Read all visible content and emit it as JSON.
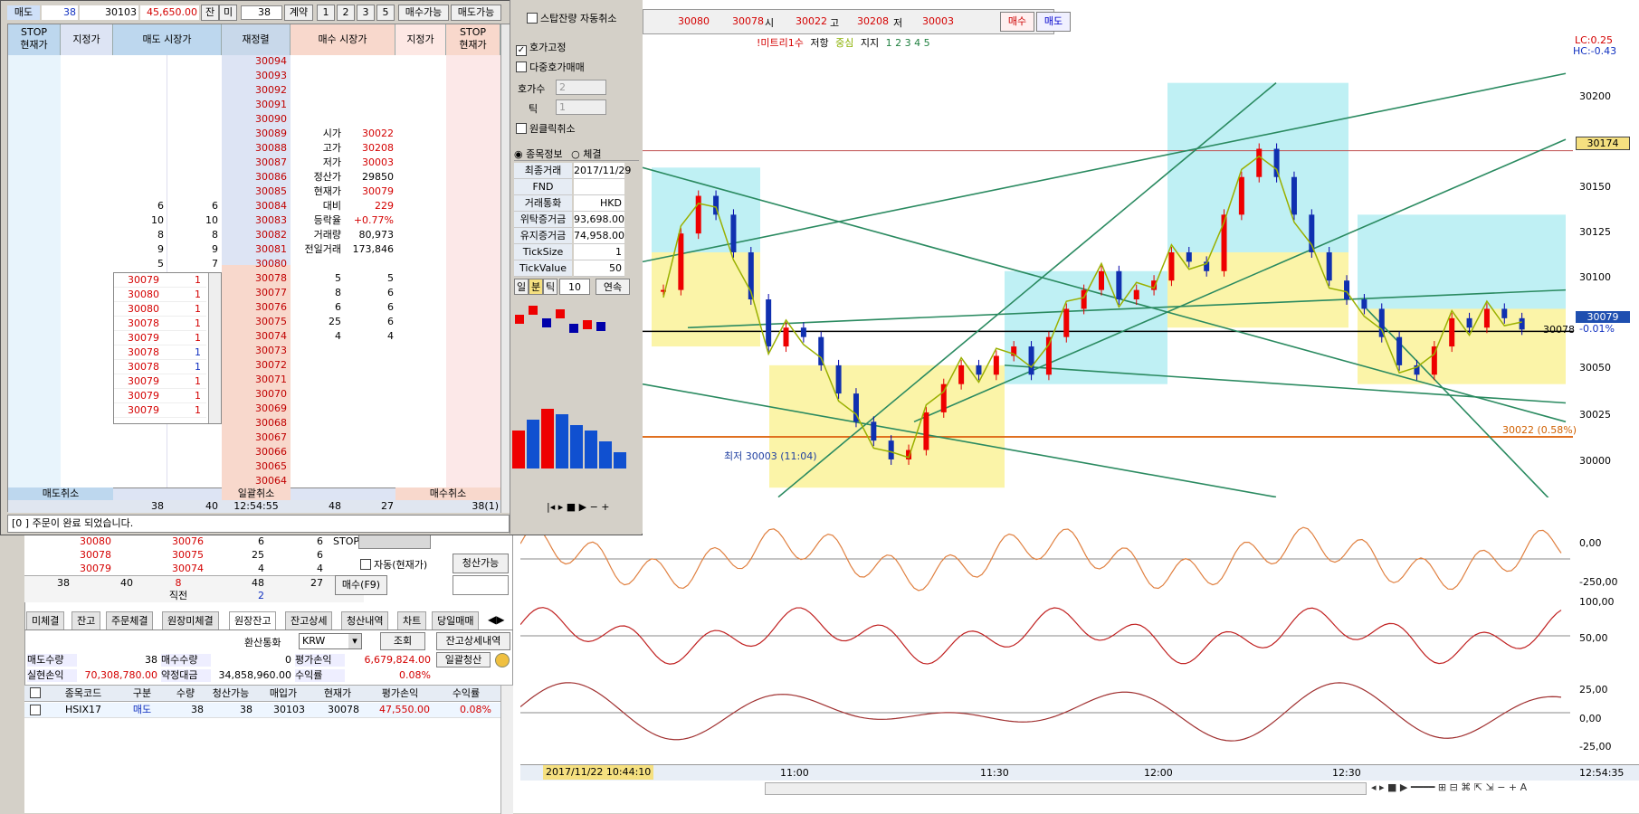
{
  "order_panel": {
    "top": {
      "side": "매도",
      "num": "38",
      "price": "30103",
      "pnl": "45,650.00",
      "bal_label": "잔",
      "rem_label": "미",
      "qty": "38",
      "contract_label": "계약",
      "q1": "1",
      "q2": "2",
      "q3": "3",
      "q4": "5",
      "buy_able": "매수가능",
      "sell_able": "매도가능"
    },
    "headers": {
      "stop_l": "STOP",
      "cur_l": "현재가",
      "limit_l": "지정가",
      "ask_mkt": "매도 시장가",
      "reset": "재정렬",
      "bid_mkt": "매수 시장가",
      "limit_r": "지정가",
      "stop_r": "STOP",
      "cur_r": "현재가"
    },
    "prices": [
      "30094",
      "30093",
      "30092",
      "30091",
      "30090",
      "30089",
      "30088",
      "30087",
      "30086",
      "30085",
      "30084",
      "30083",
      "30082",
      "30081",
      "30080",
      "30078",
      "30077",
      "30076",
      "30075",
      "30074",
      "30073",
      "30072",
      "30071",
      "30070",
      "30069",
      "30068",
      "30067",
      "30066",
      "30065",
      "30064"
    ],
    "ask_qty": [
      {
        "a": "6",
        "b": "6"
      },
      {
        "a": "10",
        "b": "10"
      },
      {
        "a": "8",
        "b": "8"
      },
      {
        "a": "9",
        "b": "9"
      },
      {
        "a": "5",
        "b": "7"
      }
    ],
    "bid_qty": [
      {
        "a": "5",
        "b": "5"
      },
      {
        "a": "8",
        "b": "6"
      },
      {
        "a": "6",
        "b": "6"
      },
      {
        "a": "25",
        "b": "6"
      },
      {
        "a": "4",
        "b": "4"
      }
    ],
    "quote_info": [
      {
        "k": "시가",
        "v": "30022",
        "c": "red"
      },
      {
        "k": "고가",
        "v": "30208",
        "c": "red"
      },
      {
        "k": "저가",
        "v": "30003",
        "c": "red"
      },
      {
        "k": "정산가",
        "v": "29850",
        "c": ""
      },
      {
        "k": "현재가",
        "v": "30079",
        "c": "red"
      },
      {
        "k": "대비",
        "v": "229",
        "c": "red"
      },
      {
        "k": "등락율",
        "v": "+0.77%",
        "c": "red"
      },
      {
        "k": "거래량",
        "v": "80,973",
        "c": ""
      },
      {
        "k": "전일거래",
        "v": "173,846",
        "c": ""
      }
    ],
    "ticks": [
      {
        "p": "30079",
        "q": "1",
        "c": "red"
      },
      {
        "p": "30080",
        "q": "1",
        "c": "red"
      },
      {
        "p": "30080",
        "q": "1",
        "c": "red"
      },
      {
        "p": "30078",
        "q": "1",
        "c": "red"
      },
      {
        "p": "30079",
        "q": "1",
        "c": "red"
      },
      {
        "p": "30078",
        "q": "1",
        "c": "blue"
      },
      {
        "p": "30078",
        "q": "1",
        "c": "blue"
      },
      {
        "p": "30079",
        "q": "1",
        "c": "red"
      },
      {
        "p": "30079",
        "q": "1",
        "c": "red"
      },
      {
        "p": "30079",
        "q": "1",
        "c": "red"
      }
    ],
    "footer": {
      "sell_cancel": "매도취소",
      "all_cancel": "일괄취소",
      "buy_cancel": "매수취소",
      "a": "38",
      "b": "40",
      "time": "12:54:55",
      "c": "48",
      "d": "27",
      "e": "38(1)"
    },
    "status": "[0     ] 주문이 완료 되었습니다."
  },
  "side_panel": {
    "split_label": "스탑잔량 자동취소",
    "fix_quote": "호가고정",
    "multi_quote": "다중호가매매",
    "quote_count_label": "호가수",
    "quote_count": "2",
    "tick_label": "틱",
    "tick_val": "1",
    "one_click": "원클릭취소",
    "tab_info": "종목정보",
    "tab_exec": "체결",
    "info": [
      {
        "k": "최종거래",
        "v": "2017/11/29"
      },
      {
        "k": "FND",
        "v": ""
      },
      {
        "k": "거래통화",
        "v": "HKD"
      },
      {
        "k": "위탁증거금",
        "v": "93,698.00"
      },
      {
        "k": "유지증거금",
        "v": "74,958.00"
      },
      {
        "k": "TickSize",
        "v": "1"
      },
      {
        "k": "TickValue",
        "v": "50"
      }
    ],
    "period": {
      "day": "일",
      "min": "분",
      "tick": "틱",
      "n": "10",
      "cont": "연속"
    }
  },
  "lower": {
    "rows": [
      {
        "p": "30080",
        "x": "30076",
        "y": "6",
        "z": "6"
      },
      {
        "p": "30078",
        "x": "30075",
        "y": "25",
        "z": "6"
      },
      {
        "p": "30079",
        "x": "30074",
        "y": "4",
        "z": "4"
      }
    ],
    "sum": {
      "a": "38",
      "b": "40",
      "c": "8",
      "d": "48",
      "e": "27"
    },
    "prev": "직전",
    "prev_v": "2",
    "stop": "STOP",
    "auto": "자동(현재가)",
    "clear_able": "청산가능",
    "buy_f9": "매수(F9)",
    "tabs": [
      "미체결",
      "잔고",
      "주문체결",
      "원장미체결",
      "원장잔고",
      "잔고상세",
      "청산내역",
      "차트",
      "당일매매"
    ],
    "currency_label": "환산통화",
    "currency": "KRW",
    "query": "조회",
    "detail": "잔고상세내역",
    "sum_rows": {
      "sell_qty_l": "매도수량",
      "sell_qty": "38",
      "buy_qty_l": "매수수량",
      "buy_qty": "0",
      "eval_l": "평가손익",
      "eval": "6,679,824.00",
      "bulk": "일괄청산",
      "real_l": "실현손익",
      "real": "70,308,780.00",
      "contract_l": "약정대금",
      "contract": "34,858,960.00",
      "rate_l": "수익률",
      "rate": "0.08%"
    },
    "cols": [
      "종목코드",
      "구분",
      "수량",
      "청산가능",
      "매입가",
      "현재가",
      "평가손익",
      "수익률"
    ],
    "pos": {
      "code": "HSIX17",
      "side": "매도",
      "qty": "38",
      "clear": "38",
      "buy": "30103",
      "cur": "30078",
      "pnl": "47,550.00",
      "rate": "0.08%"
    }
  },
  "chart_top": {
    "o": "30080",
    "h": "30078",
    "l_label": "시",
    "c": "30022",
    "hi_label": "고",
    "hv": "30208",
    "lo_label": "저",
    "lv": "30003",
    "buy": "매수",
    "sell": "매도"
  },
  "chart_legend": {
    "t1": "!미트리1수",
    "t2": "저항",
    "t3": "중심",
    "t4": "지지",
    "nums": "1 2 3 4 5"
  },
  "chart_data": [
    {
      "type": "candlestick",
      "title": "",
      "y_ticks": [
        "30200",
        "30150",
        "30125",
        "30100",
        "30050",
        "30025",
        "30000"
      ],
      "ylim": [
        29985,
        30230
      ],
      "x_ticks": [
        "11:00",
        "11:30",
        "12:00",
        "12:30"
      ],
      "x_start": "2017/11/22 10:44:10",
      "x_end_time": "12:54:35",
      "last": "30079",
      "last_pct": "-0.01%",
      "marker": "30174",
      "ref_line": "30078",
      "open_line": "30022 (0.58%)",
      "low_note": "최저 30003 (11:04)",
      "lc": "LC:0.25",
      "hc": "HC:-0.43",
      "close": [
        30100,
        30130,
        30150,
        30140,
        30120,
        30095,
        30070,
        30080,
        30075,
        30060,
        30045,
        30030,
        30020,
        30010,
        30015,
        30035,
        30050,
        30060,
        30055,
        30065,
        30070,
        30055,
        30075,
        30090,
        30100,
        30110,
        30095,
        30100,
        30105,
        30120,
        30115,
        30110,
        30140,
        30160,
        30175,
        30160,
        30140,
        30120,
        30105,
        30095,
        30090,
        30075,
        30060,
        30055,
        30070,
        30085,
        30080,
        30090,
        30085,
        30079
      ]
    },
    {
      "type": "line",
      "name": "osc1",
      "y_ticks": [
        "0,00",
        "-250,00"
      ]
    },
    {
      "type": "line",
      "name": "osc2",
      "y_ticks": [
        "100,00",
        "50,00"
      ]
    },
    {
      "type": "line",
      "name": "osc3",
      "y_ticks": [
        "25,00",
        "0,00",
        "-25,00"
      ]
    }
  ]
}
